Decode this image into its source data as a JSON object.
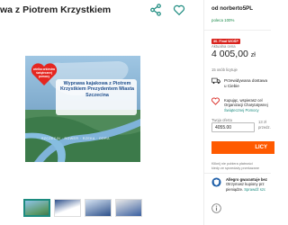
{
  "product": {
    "title": "wa z Piotrem Krzystkiem"
  },
  "hero": {
    "badge_text": "wielka orkiestra świątecznej pomocy",
    "headline": "Wyprawa kajakowa z Piotrem Krzystkiem Prezydentem Miasta Szczecina",
    "footer_text": "SZCZECIN · ROWER · RZEKA · ODRA"
  },
  "thumbnails": [
    {
      "name": "thumbnail-1"
    },
    {
      "name": "thumbnail-2"
    },
    {
      "name": "thumbnail-3"
    },
    {
      "name": "thumbnail-4"
    }
  ],
  "seller": {
    "name": "od norberto5PL",
    "recommend": "poleca 100%"
  },
  "buy": {
    "badge": "30. Finał WOŚP",
    "price_label": "Aktualna cena",
    "price_main": "4 005,00",
    "price_currency": "zł",
    "buyers": "15 osób licytuje",
    "delivery_line1": "Przewidywana dostawa",
    "delivery_line2": "u Ciebie",
    "charity_line1": "Kupując, wspierasz cel",
    "charity_line2": "Organizacji Charytatywnej",
    "charity_link": "Świątecznej Pomocy",
    "offer_label": "Twoja oferta",
    "offer_value": "4055.00",
    "offer_hint_line1": "13 zł",
    "offer_hint_line2": "przedz.",
    "cta": "LICY",
    "note_line1": "Kliknij nie pobiera płatności",
    "note_line2": "kiedy ze sprzedaży przekazane"
  },
  "guarantee": {
    "title": "Allegro gwarantuje bez",
    "line2": "Otrzymasz kupiony prz",
    "line3": "pieniądze.",
    "link": "Sprawdź szc"
  },
  "colors": {
    "accent": "#ff5a00",
    "teal": "#1c8b7f",
    "red_badge": "#d9241e",
    "hero_sky": "#6fa4c8"
  },
  "icons": {
    "share": "share-icon",
    "favorite": "heart-icon",
    "delivery": "truck-icon",
    "charity": "heart-icon",
    "guarantee": "shield-icon",
    "info": "info-icon"
  }
}
